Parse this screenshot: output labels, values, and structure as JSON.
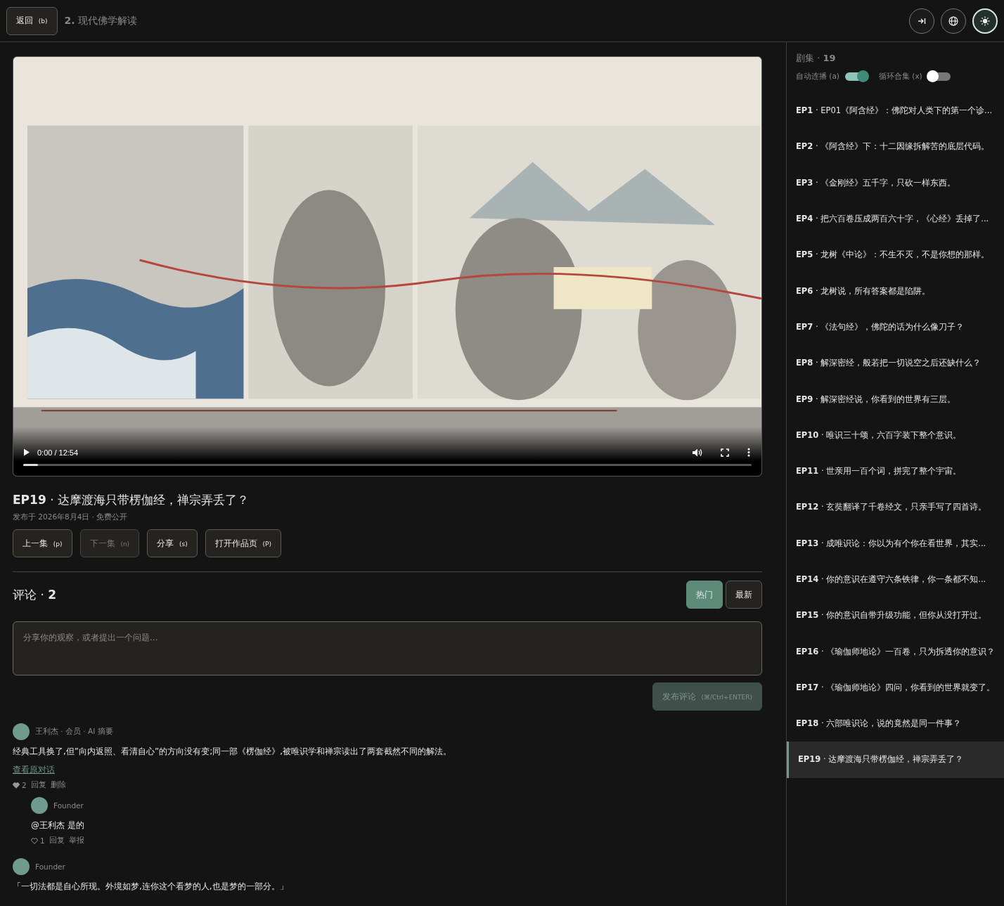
{
  "top_bar": {
    "back_button": {
      "label": "返回",
      "shortcut": "(b)"
    },
    "breadcrumb": {
      "number": "2.",
      "title": "现代佛学解读"
    },
    "icon_buttons": [
      {
        "kind": "collapse",
        "selected": false
      },
      {
        "kind": "language",
        "selected": false
      },
      {
        "kind": "theme",
        "selected": true
      }
    ]
  },
  "video": {
    "time": "0:00 / 12:54",
    "progress": {
      "level": 0.02
    }
  },
  "episode": {
    "title": "**EP19** · 达摩渡海只带楞伽经，禅宗弄丢了？",
    "meta": "发布于 2026年8月4日 · 免费公开",
    "buttons": [
      {
        "label": "上一集",
        "shortcut": "(p)",
        "disabled": false
      },
      {
        "label": "下一集",
        "shortcut": "(n)",
        "disabled": true
      },
      {
        "label": "分享",
        "shortcut": "(s)",
        "disabled": false
      },
      {
        "label": "打开作品页",
        "shortcut": "(P)",
        "disabled": false
      }
    ]
  },
  "comments": {
    "heading": "评论 · **2**",
    "sort_tabs": [
      {
        "label": "热门",
        "selected": true
      },
      {
        "label": "最新",
        "selected": false
      }
    ],
    "input": {
      "placeholder": "分享你的观察，或者提出一个问题..."
    },
    "submit": {
      "label": "发布评论",
      "shortcut": "(⌘/Ctrl+ENTER)",
      "disabled": true
    },
    "items": [
      {
        "meta": "王利杰 · 会员 · AI 摘要",
        "text": "经典工具换了,但”向内返照、看清自心”的方向没有变;同一部《楞伽经》,被唯识学和禅宗读出了两套截然不同的解法。",
        "link": "查看原对话",
        "likes": "2",
        "liked": true,
        "actions": [
          "回复",
          "删除"
        ],
        "replies": [
          {
            "meta": "Founder",
            "text": "@王利杰 是的",
            "likes": "1",
            "liked": false,
            "actions": [
              "回复",
              "举报"
            ]
          }
        ]
      },
      {
        "meta": "Founder",
        "text": "「一切法都是自心所现。外境如梦,连你这个看梦的人,也是梦的一部分。」"
      }
    ]
  },
  "sidebar": {
    "heading": "剧集 · **19**",
    "toggles": [
      {
        "label": "自动连播 (a)",
        "on": true
      },
      {
        "label": "循环合集 (x)",
        "on": false
      }
    ],
    "episodes": [
      {
        "title": "**EP1** · EP01《阿含经》：佛陀对人类下的第一个诊...",
        "selected": false
      },
      {
        "title": "**EP2** · 《阿含经》下：十二因缘拆解苦的底层代码。",
        "selected": false
      },
      {
        "title": "**EP3** · 《金刚经》五千字，只砍一样东西。",
        "selected": false
      },
      {
        "title": "**EP4** · 把六百卷压成两百六十字，《心经》丢掉了...",
        "selected": false
      },
      {
        "title": "**EP5** · 龙树《中论》：不生不灭，不是你想的那样。",
        "selected": false
      },
      {
        "title": "**EP6** · 龙树说，所有答案都是陷阱。",
        "selected": false
      },
      {
        "title": "**EP7** · 《法句经》，佛陀的话为什么像刀子？",
        "selected": false
      },
      {
        "title": "**EP8** · 解深密经，般若把一切说空之后还缺什么？",
        "selected": false
      },
      {
        "title": "**EP9** · 解深密经说，你看到的世界有三层。",
        "selected": false
      },
      {
        "title": "**EP10** · 唯识三十颂，六百字装下整个意识。",
        "selected": false
      },
      {
        "title": "**EP11** · 世亲用一百个词，拼完了整个宇宙。",
        "selected": false
      },
      {
        "title": "**EP12** · 玄奘翻译了千卷经文，只亲手写了四首诗。",
        "selected": false
      },
      {
        "title": "**EP13** · 成唯识论：你以为有个你在看世界，其实...",
        "selected": false
      },
      {
        "title": "**EP14** · 你的意识在遵守六条铁律，你一条都不知...",
        "selected": false
      },
      {
        "title": "**EP15** · 你的意识自带升级功能，但你从没打开过。",
        "selected": false
      },
      {
        "title": "**EP16** · 《瑜伽师地论》一百卷，只为拆透你的意识？",
        "selected": false
      },
      {
        "title": "**EP17** · 《瑜伽师地论》四问，你看到的世界就变了。",
        "selected": false
      },
      {
        "title": "**EP18** · 六部唯识论，说的竟然是同一件事？",
        "selected": false
      },
      {
        "title": "**EP19** · 达摩渡海只带楞伽经，禅宗弄丢了？",
        "selected": true
      }
    ]
  }
}
